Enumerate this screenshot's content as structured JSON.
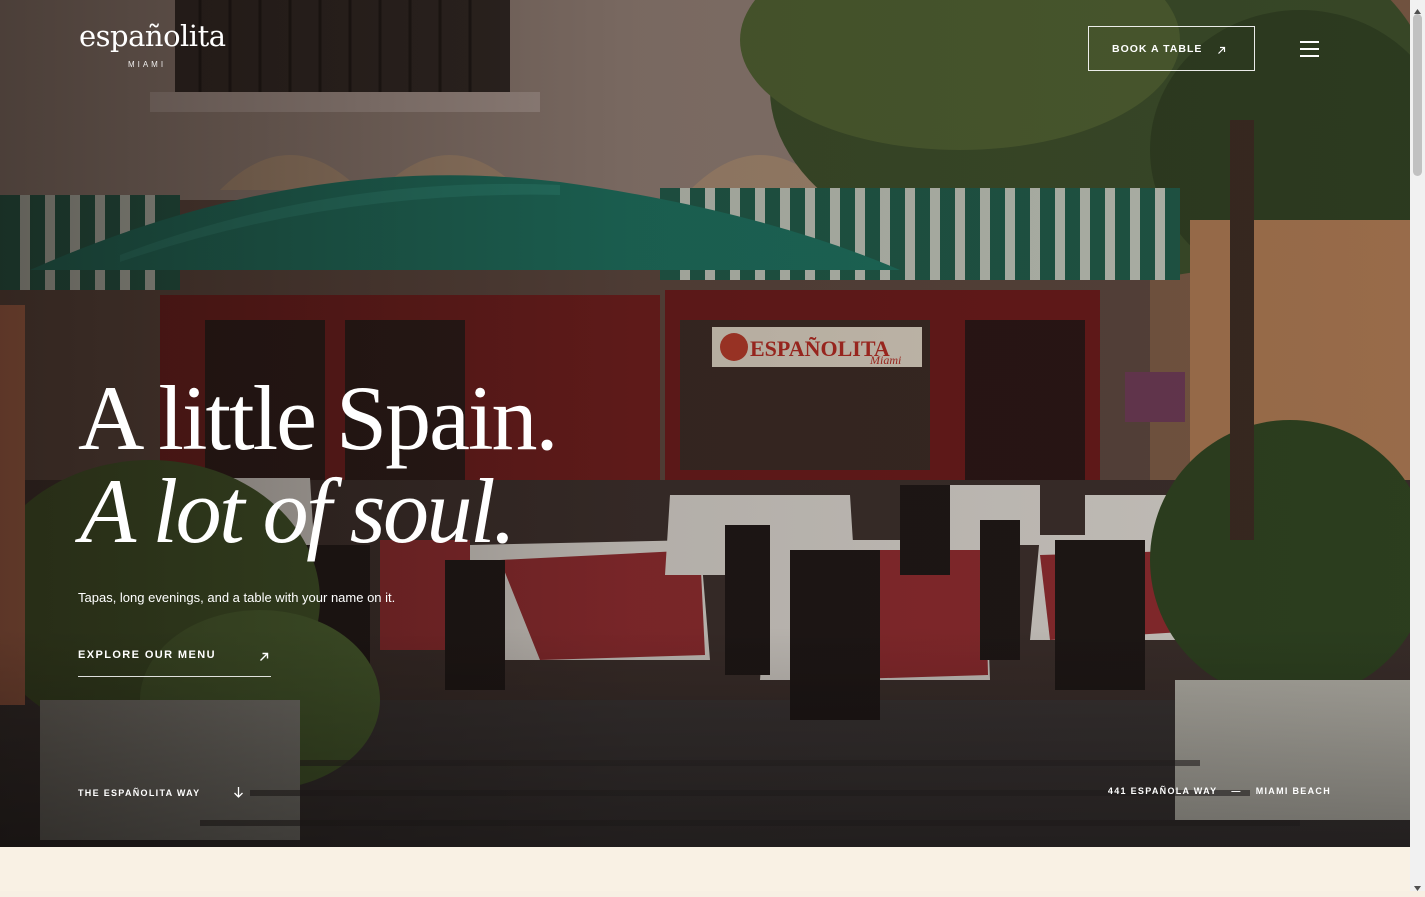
{
  "header": {
    "logo_word": "españolita",
    "logo_sub": "MIAMI",
    "book_label": "BOOK A TABLE"
  },
  "hero": {
    "headline_line1": "A little Spain.",
    "headline_line2": "A lot of soul.",
    "tagline": "Tapas, long evenings, and a table with your name on it.",
    "cta_label": "EXPLORE OUR MENU",
    "sign_text": "ESPAÑOLITA",
    "sign_sub": "Miami"
  },
  "footer_bar": {
    "way_label": "THE ESPAÑOLITA WAY",
    "address_street": "441 ESPAÑOLA WAY",
    "address_sep": "—",
    "address_city": "MIAMI BEACH"
  },
  "colors": {
    "cream": "#f9f1e4",
    "awning_green": "#1f6b55",
    "tablecloth_red": "#8e2b2f",
    "text": "#ffffff"
  },
  "icons": [
    "arrow-up-right-icon",
    "menu-icon",
    "arrow-down-icon"
  ]
}
